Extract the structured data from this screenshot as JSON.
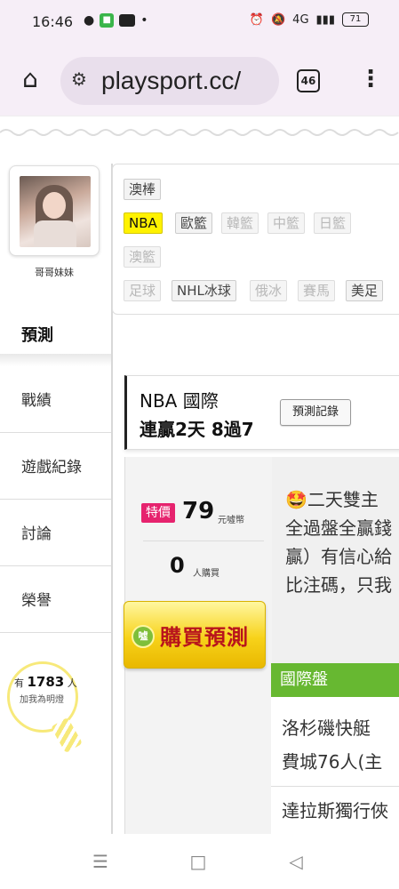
{
  "status_bar": {
    "time": "16:46",
    "battery": "71",
    "network": "4G"
  },
  "browser": {
    "url": "playsport.cc/",
    "tab_count": "46"
  },
  "profile": {
    "username": "哥哥妹妹"
  },
  "sidebar": {
    "active": "預測",
    "items": [
      {
        "label": "戰績"
      },
      {
        "label": "遊戲紀錄"
      },
      {
        "label": "討論"
      },
      {
        "label": "榮譽"
      }
    ]
  },
  "fans": {
    "prefix": "有",
    "count": "1783",
    "suffix": "人",
    "label": "加我為明燈"
  },
  "leagues": {
    "row1": [
      {
        "label": "澳棒",
        "state": "normal"
      }
    ],
    "row2": [
      {
        "label": "NBA",
        "state": "active"
      },
      {
        "label": "歐籃",
        "state": "normal"
      },
      {
        "label": "韓籃",
        "state": "dim"
      },
      {
        "label": "中籃",
        "state": "dim"
      },
      {
        "label": "日籃",
        "state": "dim"
      }
    ],
    "row3": [
      {
        "label": "澳籃",
        "state": "dim"
      }
    ],
    "row4": [
      {
        "label": "足球",
        "state": "dim"
      },
      {
        "label": "NHL冰球",
        "state": "normal"
      },
      {
        "label": "俄冰",
        "state": "dim"
      },
      {
        "label": "賽馬",
        "state": "dim"
      },
      {
        "label": "美足",
        "state": "normal"
      }
    ]
  },
  "game": {
    "title": "NBA 國際",
    "record": "連贏2天 8過7",
    "history_button": "預測記錄"
  },
  "pricing": {
    "badge": "特價",
    "price": "79",
    "currency": "元噓幣",
    "buyers": "0",
    "buyers_label": "人購買",
    "buy_button": "購買預測",
    "coin_label": "噓"
  },
  "description": {
    "line1": "🤩二天雙主",
    "line2": "全過盤全贏錢",
    "line3": "贏）有信心給",
    "line4": "比注碼，只我"
  },
  "odds": {
    "header": "國際盤",
    "match1_line1": "洛杉磯快艇",
    "match1_line2": "費城76人(主",
    "match2_line1": "達拉斯獨行俠"
  },
  "system_nav": {
    "menu": "☰",
    "home": "□",
    "back": "◁"
  }
}
